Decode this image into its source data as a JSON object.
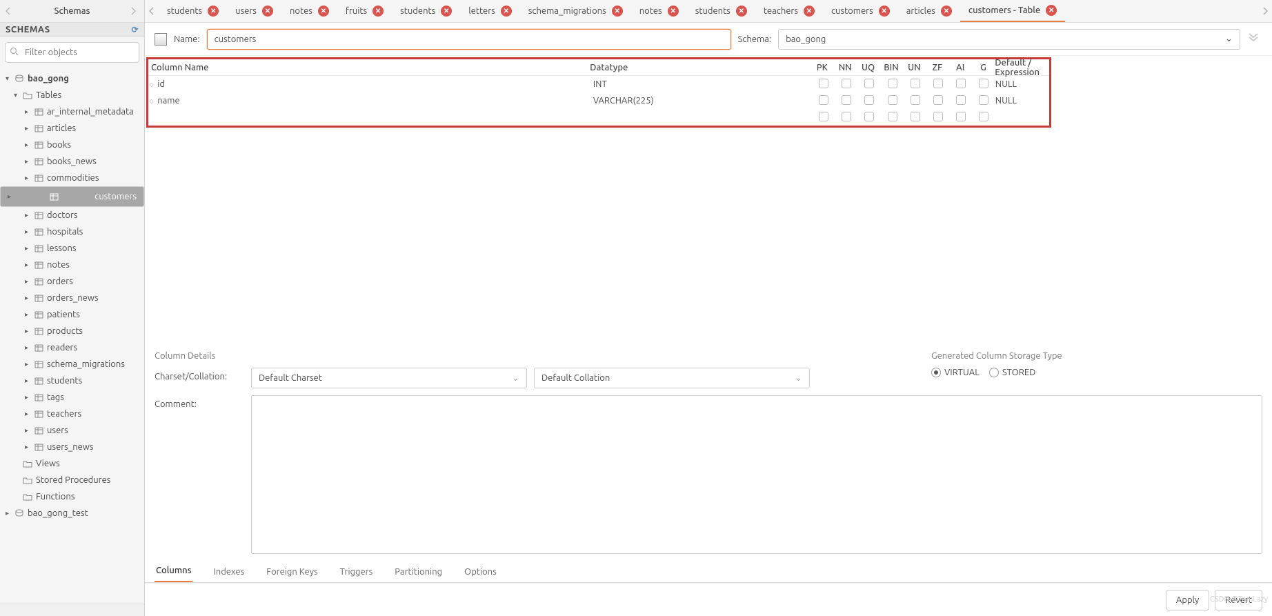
{
  "sidebar": {
    "title": "Schemas",
    "section": "SCHEMAS",
    "filter_placeholder": "Filter objects",
    "tree": {
      "db": "bao_gong",
      "tables_label": "Tables",
      "tables": [
        "ar_internal_metadata",
        "articles",
        "books",
        "books_news",
        "commodities",
        "customers",
        "doctors",
        "hospitals",
        "lessons",
        "notes",
        "orders",
        "orders_news",
        "patients",
        "products",
        "readers",
        "schema_migrations",
        "students",
        "tags",
        "teachers",
        "users",
        "users_news"
      ],
      "selected": "customers",
      "views": "Views",
      "sp": "Stored Procedures",
      "fn": "Functions",
      "db2": "bao_gong_test"
    }
  },
  "tabs": [
    {
      "label": "students"
    },
    {
      "label": "users"
    },
    {
      "label": "notes"
    },
    {
      "label": "fruits"
    },
    {
      "label": "students"
    },
    {
      "label": "letters"
    },
    {
      "label": "schema_migrations"
    },
    {
      "label": "notes"
    },
    {
      "label": "students"
    },
    {
      "label": "teachers"
    },
    {
      "label": "customers"
    },
    {
      "label": "articles"
    },
    {
      "label": "customers - Table",
      "active": true
    }
  ],
  "toolbar": {
    "name_label": "Name:",
    "name_value": "customers",
    "schema_label": "Schema:",
    "schema_value": "bao_gong"
  },
  "grid": {
    "headers": {
      "name": "Column Name",
      "dt": "Datatype",
      "pk": "PK",
      "nn": "NN",
      "uq": "UQ",
      "bin": "BIN",
      "un": "UN",
      "zf": "ZF",
      "ai": "AI",
      "g": "G",
      "def": "Default / Expression"
    },
    "rows": [
      {
        "name": "id",
        "dt": "INT",
        "def": "NULL"
      },
      {
        "name": "name",
        "dt": "VARCHAR(225)",
        "def": "NULL"
      }
    ]
  },
  "details": {
    "title": "Column Details",
    "charset_label": "Charset/Collation:",
    "charset_ph": "Default Charset",
    "collation_ph": "Default Collation",
    "comment_label": "Comment:",
    "storage_title": "Generated Column Storage Type",
    "virtual": "VIRTUAL",
    "stored": "STORED"
  },
  "btabs": [
    "Columns",
    "Indexes",
    "Foreign Keys",
    "Triggers",
    "Partitioning",
    "Options"
  ],
  "footer": {
    "apply": "Apply",
    "revert": "Revert"
  },
  "watermark": "CSDN @TomLazy"
}
